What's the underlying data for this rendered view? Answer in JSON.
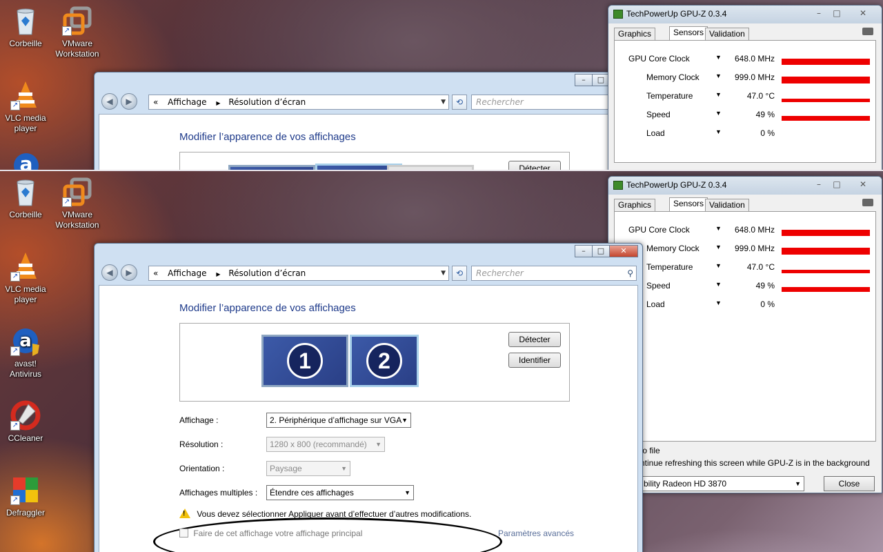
{
  "desktop": {
    "icons_top": [
      {
        "label": "Corbeille",
        "icon": "recycle-bin-icon"
      },
      {
        "label": "VMware Workstation",
        "icon": "vmware-icon"
      },
      {
        "label": "VLC media player",
        "icon": "vlc-icon"
      }
    ],
    "icons_bottom": [
      {
        "label": "Corbeille",
        "icon": "recycle-bin-icon"
      },
      {
        "label": "VMware Workstation",
        "icon": "vmware-icon"
      },
      {
        "label": "VLC media player",
        "icon": "vlc-icon"
      },
      {
        "label": "avast! Antivirus",
        "icon": "avast-icon"
      },
      {
        "label": "CCleaner",
        "icon": "ccleaner-icon"
      },
      {
        "label": "Defraggler",
        "icon": "defraggler-icon"
      }
    ]
  },
  "display_window": {
    "breadcrumb_prefix": "«",
    "breadcrumb": [
      "Affichage",
      "Résolution d’écran"
    ],
    "search_placeholder": "Rechercher",
    "heading": "Modifier l’apparence de vos affichages",
    "monitors": [
      "1",
      "2"
    ],
    "detect_label": "Détecter",
    "identify_label": "Identifier",
    "display_label": "Affichage :",
    "display_value": "2. Périphérique d’affichage sur VGA",
    "resolution_label": "Résolution :",
    "resolution_value": "1280 x 800 (recommandé)",
    "orientation_label": "Orientation :",
    "orientation_value": "Paysage",
    "multiple_label": "Affichages multiples :",
    "multiple_value": "Étendre ces affichages",
    "warning": "Vous devez sélectionner Appliquer avant d’effectuer d’autres modifications.",
    "primary_checkbox": "Faire de cet affichage votre affichage principal",
    "advanced_link": "Paramètres avancés",
    "colors": {
      "heading": "#1e3a8a",
      "monitor": "#3c5aa8"
    }
  },
  "gpuz_window": {
    "title": "TechPowerUp GPU-Z 0.3.4",
    "tabs": [
      "Graphics Card",
      "Sensors",
      "Validation"
    ],
    "active_tab": "Sensors",
    "sensors": [
      {
        "name": "GPU Core Clock",
        "name_cut": "GPU Core Clock",
        "value": "648.0 MHz",
        "level": 0.72
      },
      {
        "name": "Memory Clock",
        "name_cut": "Memory Clock",
        "value": "999.0 MHz",
        "level": 0.8
      },
      {
        "name": "Temperature",
        "name_cut": "Temperature",
        "value": "47.0 °C",
        "level": 0.45
      },
      {
        "name": "Speed",
        "name_cut": "Speed",
        "value": "49 %",
        "level": 0.62
      },
      {
        "name": "Load",
        "name_cut": "Load",
        "value": "0 %",
        "level": 0
      }
    ],
    "log_option": "to file",
    "refresh_option": "ntinue refreshing this screen while GPU-Z is in the background",
    "gpu_select": "bility Radeon HD 3870",
    "close_label": "Close",
    "colors": {
      "bar": "#ee0000"
    }
  }
}
